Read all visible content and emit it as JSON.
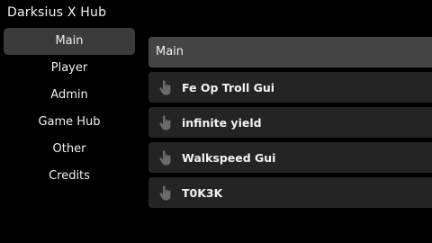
{
  "app": {
    "title": "Darksius X Hub"
  },
  "sidebar": {
    "items": [
      {
        "label": "Main",
        "active": true
      },
      {
        "label": "Player",
        "active": false
      },
      {
        "label": "Admin",
        "active": false
      },
      {
        "label": "Game Hub",
        "active": false
      },
      {
        "label": "Other",
        "active": false
      },
      {
        "label": "Credits",
        "active": false
      }
    ]
  },
  "main": {
    "header": "Main",
    "scripts": [
      {
        "label": "Fe Op Troll Gui",
        "icon": "pointer-hand-icon"
      },
      {
        "label": "infinite yield",
        "icon": "pointer-hand-icon"
      },
      {
        "label": "Walkspeed Gui",
        "icon": "pointer-hand-icon"
      },
      {
        "label": "T0K3K",
        "icon": "pointer-hand-icon"
      }
    ]
  },
  "colors": {
    "background": "#000000",
    "active_nav": "#3b3b3b",
    "header": "#444444",
    "item": "#242424"
  }
}
